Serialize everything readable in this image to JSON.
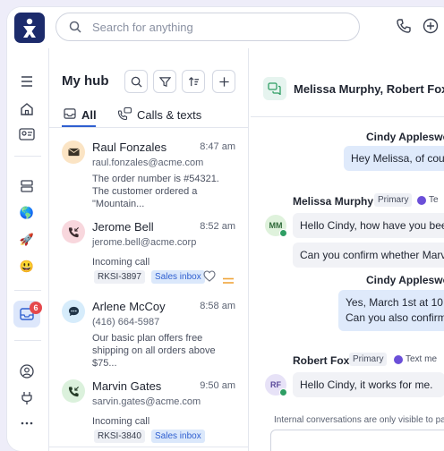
{
  "search": {
    "placeholder": "Search for anything"
  },
  "rail": {
    "inbox_badge": "6"
  },
  "hub": {
    "title": "My hub",
    "tabs": [
      {
        "label": "All",
        "active": true
      },
      {
        "label": "Calls & texts",
        "active": false
      }
    ],
    "conversations": [
      {
        "name": "Raul Fonzales",
        "time": "8:47 am",
        "sub": "raul.fonzales@acme.com",
        "body": "The order number is #54321. The customer ordered a \"Mountain...",
        "avatar_color": "#fbe4c4",
        "icon": "email-icon"
      },
      {
        "name": "Jerome Bell",
        "time": "8:52 am",
        "sub": "jerome.bell@acme.corp",
        "body": "Incoming call",
        "chip_id": "RKSI-3897",
        "chip_inbox": "Sales inbox",
        "avatar_color": "#f8d7dd",
        "icon": "phone-incoming-icon"
      },
      {
        "name": "Arlene McCoy",
        "time": "8:58 am",
        "sub": "(416) 664-5987",
        "body": "Our basic plan offers free shipping on all orders above $75...",
        "avatar_color": "#d6ecfb",
        "icon": "chat-bubble-icon"
      },
      {
        "name": "Marvin Gates",
        "time": "9:50 am",
        "sub": "sarvin.gates@acme.com",
        "body": "Incoming call",
        "chip_id": "RKSI-3840",
        "chip_inbox": "Sales inbox",
        "avatar_color": "#dbf1dc",
        "icon": "phone-incoming-icon"
      }
    ]
  },
  "chat": {
    "title": "Melissa Murphy, Robert Fox, and...",
    "messages": [
      {
        "sender": "Cindy Appleswo",
        "text": "Hey Melissa, of cour",
        "direction": "out"
      },
      {
        "sender": "Melissa Murphy",
        "tag": "Primary",
        "meta": "Te",
        "initials": "MM",
        "avatar_color": "#dff2dc",
        "direction": "in",
        "lines": [
          "Hello Cindy, how have you bee",
          "Can you confirm whether Marv"
        ]
      },
      {
        "sender": "Cindy Appleswo",
        "direction": "out",
        "lines": [
          "Yes, March 1st at 10",
          "Can you also confirm"
        ]
      },
      {
        "sender": "Robert Fox",
        "tag": "Primary",
        "meta": "Text me",
        "initials": "RF",
        "avatar_color": "#e7e2f7",
        "direction": "in",
        "lines": [
          "Hello Cindy, it works for me."
        ]
      }
    ],
    "note": "Internal conversations are only visible to pa"
  }
}
